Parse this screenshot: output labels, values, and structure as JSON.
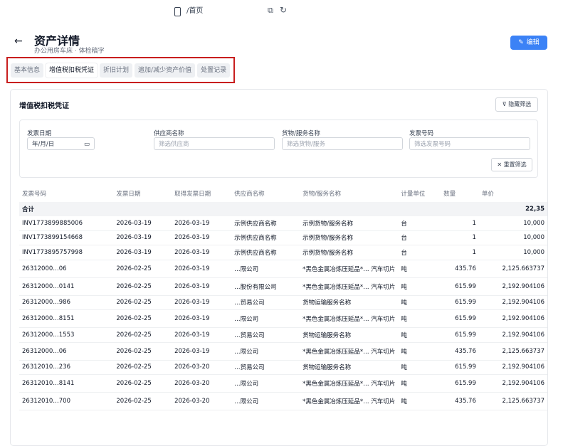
{
  "browser": {
    "url": "/首页"
  },
  "header": {
    "title": "资产详情",
    "subtitle": "办公用房车床 · 体检稿字",
    "edit_label": "编辑"
  },
  "tabs": [
    "基本信息",
    "增值税扣税凭证",
    "折旧计划",
    "追加/减少资产价值",
    "处置记录"
  ],
  "section": {
    "title": "增值税扣税凭证",
    "filter_label": "隐藏筛选"
  },
  "filters": {
    "date_label": "发票日期",
    "date_value": "年/月/日",
    "supplier_label": "供应商名称",
    "supplier_placeholder": "筛选供应商",
    "goods_label": "货物/服务名称",
    "goods_placeholder": "筛选货物/服务",
    "invoice_label": "发票号码",
    "invoice_placeholder": "筛选发票号码",
    "reset_label": "重置筛选"
  },
  "table": {
    "columns": [
      "发票号码",
      "发票日期",
      "取得发票日期",
      "供应商名称",
      "货物/服务名称",
      "计量单位",
      "数量",
      "单价"
    ],
    "total_label": "合计",
    "total_value": "22,35",
    "rows": [
      [
        "INV1773899885006",
        "2026-03-19",
        "2026-03-19",
        "示例供应商名称",
        "示例货物/服务名称",
        "台",
        "1",
        "10,000"
      ],
      [
        "INV1773899154668",
        "2026-03-19",
        "2026-03-19",
        "示例供应商名称",
        "示例货物/服务名称",
        "台",
        "1",
        "10,000"
      ],
      [
        "INV1773895757998",
        "2026-03-19",
        "2026-03-19",
        "示例供应商名称",
        "示例货物/服务名称",
        "台",
        "1",
        "10,000"
      ],
      [
        "26312000…06",
        "2026-02-25",
        "2026-03-19",
        "…限公司",
        "*黑色金属冶炼压延品*… 汽车切片",
        "吨",
        "435.76",
        "2,125.663737"
      ],
      [
        "26312000…0141",
        "2026-02-25",
        "2026-03-19",
        "…股份有限公司",
        "*黑色金属冶炼压延品*… 汽车切片",
        "吨",
        "615.99",
        "2,192.904106"
      ],
      [
        "26312000…986",
        "2026-02-25",
        "2026-03-19",
        "…贸易公司",
        "货物运输服务名称",
        "吨",
        "615.99",
        "2,192.904106"
      ],
      [
        "26312000…8151",
        "2026-02-25",
        "2026-03-19",
        "…限公司",
        "*黑色金属冶炼压延品*… 汽车切片",
        "吨",
        "615.99",
        "2,192.904106"
      ],
      [
        "26312000…1553",
        "2026-02-25",
        "2026-03-19",
        "…贸易公司",
        "货物运输服务名称",
        "吨",
        "615.99",
        "2,192.904106"
      ],
      [
        "26312000…06",
        "2026-02-25",
        "2026-03-19",
        "…限公司",
        "*黑色金属冶炼压延品*… 汽车切片",
        "吨",
        "435.76",
        "2,125.663737"
      ],
      [
        "26312010…236",
        "2026-02-25",
        "2026-03-20",
        "…贸易公司",
        "货物运输服务名称",
        "吨",
        "615.99",
        "2,192.904106"
      ],
      [
        "26312010…8141",
        "2026-02-25",
        "2026-03-20",
        "…限公司",
        "*黑色金属冶炼压延品*… 汽车切片",
        "吨",
        "615.99",
        "2,192.904106"
      ],
      [
        "26312010…700",
        "2026-02-25",
        "2026-03-20",
        "…限公司",
        "*黑色金属冶炼压延品*… 汽车切片",
        "吨",
        "435.76",
        "2,125.663737"
      ]
    ]
  }
}
